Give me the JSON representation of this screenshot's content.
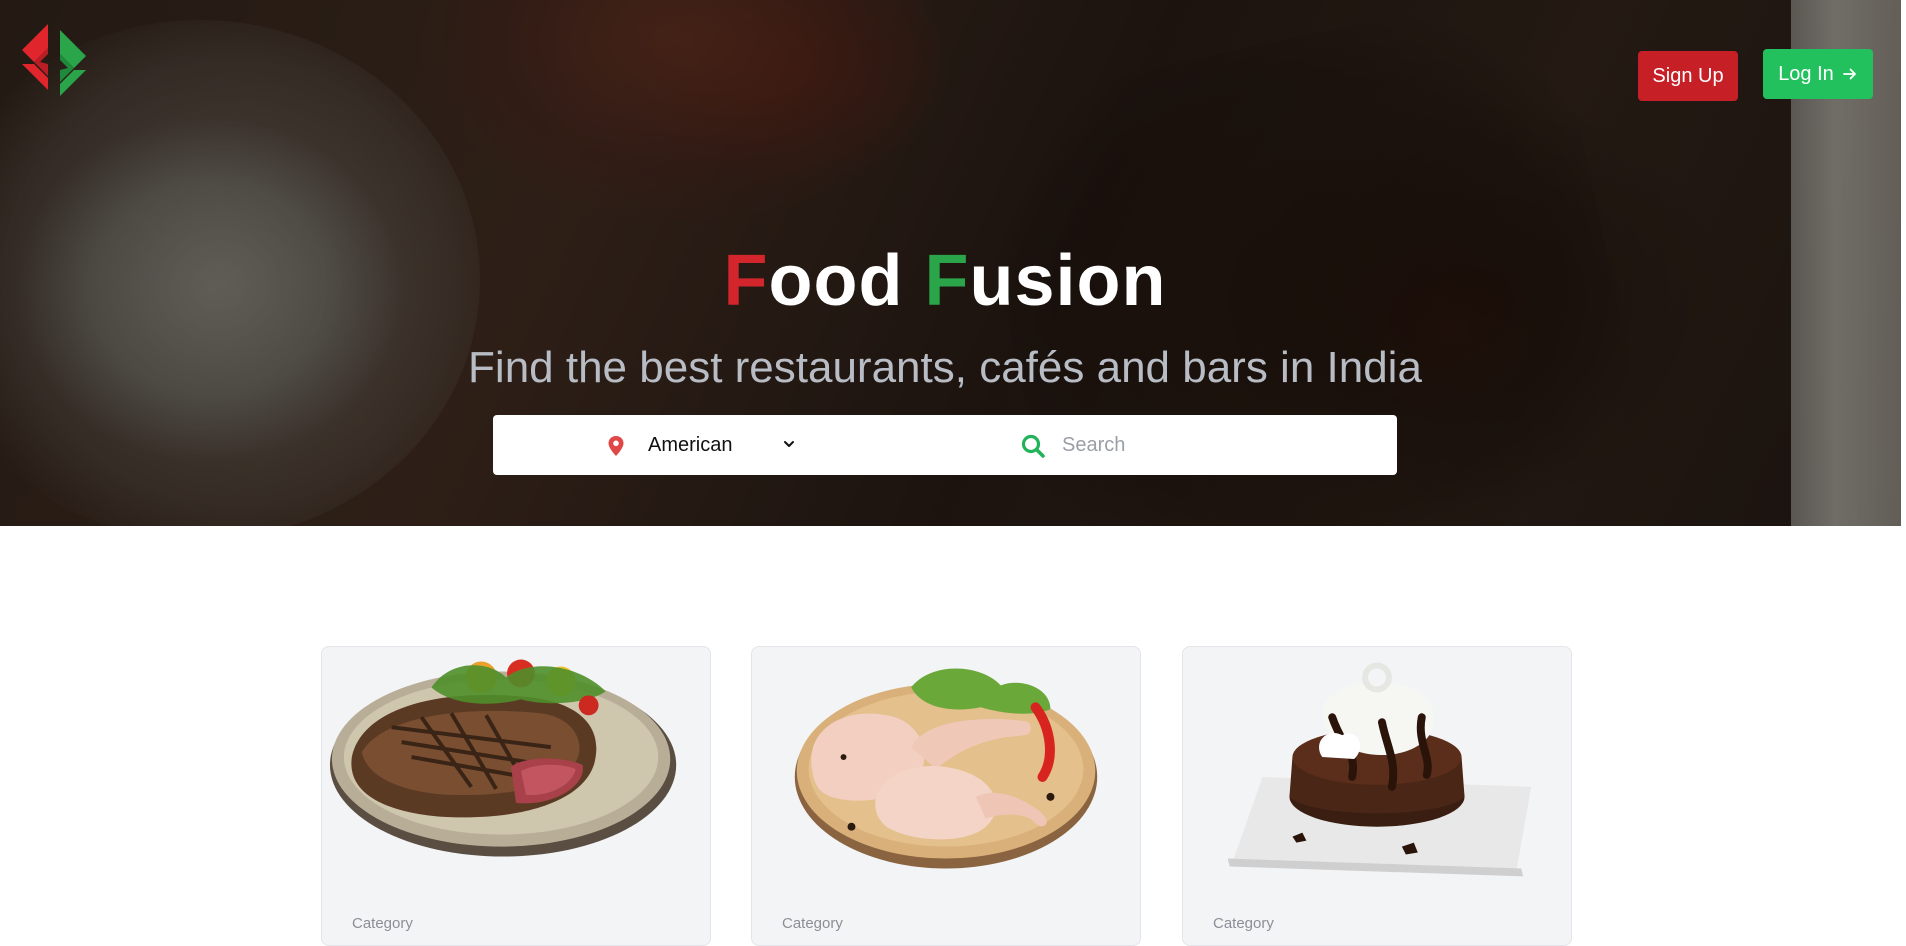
{
  "brand": {
    "title_first_initial": "F",
    "title_first_rest": "ood",
    "title_second_initial": "F",
    "title_second_rest": "usion",
    "colors": {
      "red": "#d3262c",
      "green": "#2aa54a"
    }
  },
  "header": {
    "signup_label": "Sign Up",
    "login_label": "Log In",
    "login_icon": "arrow-right-icon"
  },
  "hero": {
    "subtitle": "Find the best restaurants, cafés and bars in India"
  },
  "search": {
    "location_icon": "map-pin-icon",
    "cuisine_value": "American",
    "placeholder": "Search",
    "search_icon": "search-icon"
  },
  "cards": [
    {
      "image": "steak-plate",
      "category_label": "Category"
    },
    {
      "image": "raw-chicken-legs",
      "category_label": "Category"
    },
    {
      "image": "chocolate-lava-dessert",
      "category_label": "Category"
    }
  ],
  "colors": {
    "signup_bg": "#c62026",
    "login_bg": "#22c15e",
    "card_bg": "#f3f4f6"
  }
}
